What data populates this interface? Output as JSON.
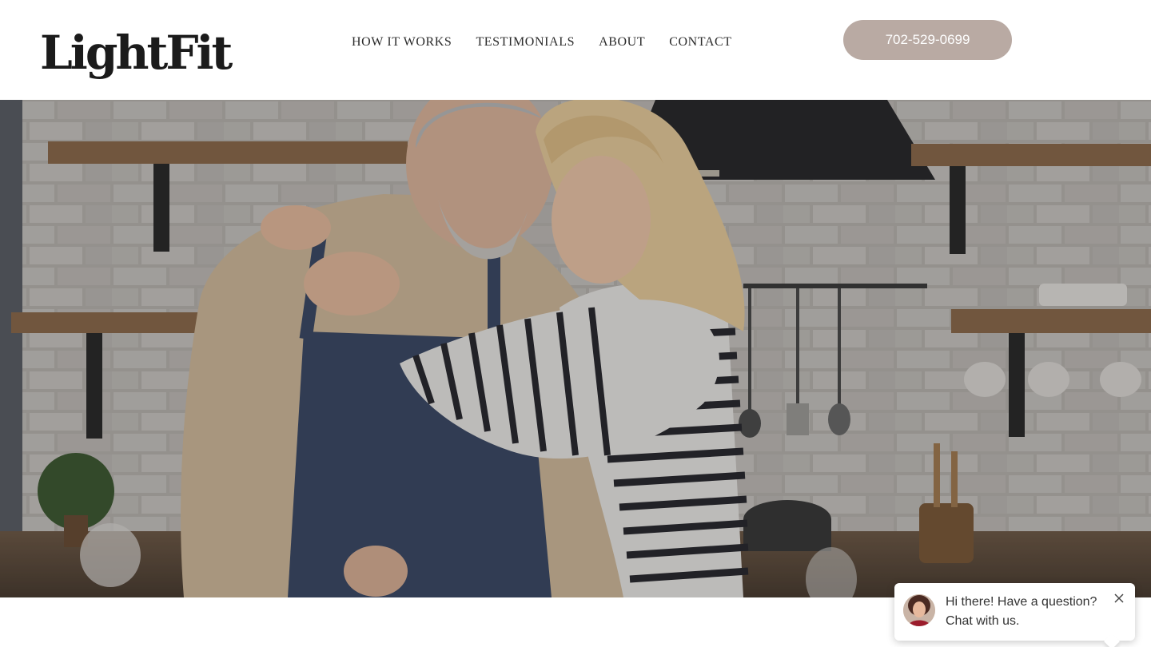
{
  "header": {
    "logo_text": "LightFit",
    "nav": [
      {
        "label": "HOW IT WORKS"
      },
      {
        "label": "TESTIMONIALS"
      },
      {
        "label": "ABOUT"
      },
      {
        "label": "CONTACT"
      }
    ],
    "phone_label": "702-529-0699"
  },
  "hero": {
    "image_subject": "older couple embracing in a kitchen",
    "overlay": "dark tint"
  },
  "chat": {
    "line1": "Hi there! Have a question?",
    "line2": "Chat with us.",
    "avatar_icon": "agent-avatar",
    "close_icon": "close-icon"
  },
  "colors": {
    "accent_button": "#b9aaa3",
    "logo": "#1b1b1b",
    "nav_text": "#2b2b2b"
  }
}
